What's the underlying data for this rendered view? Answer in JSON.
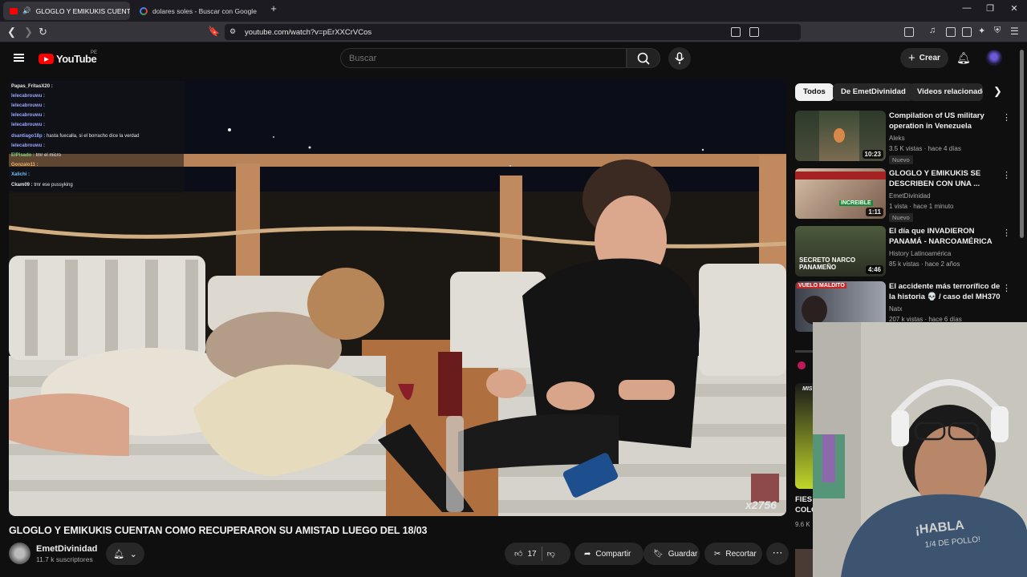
{
  "browser": {
    "tabs": [
      {
        "label": "GLOGLO Y EMIKUKIS CUENTA",
        "active": true,
        "icon": "youtube-favicon"
      },
      {
        "label": "dolares soles - Buscar con Google",
        "active": false,
        "icon": "google-favicon"
      }
    ],
    "new_tab": "+",
    "url": "youtube.com/watch?v=pErXXCrVCos"
  },
  "youtube": {
    "logo": "YouTube",
    "country": "PE",
    "search_placeholder": "Buscar",
    "create_label": "Crear"
  },
  "video": {
    "title": "GLOGLO Y EMIKUKIS CUENTAN COMO RECUPERARON SU AMISTAD LUEGO DEL 18/03",
    "channel": "EmetDivinidad",
    "subscribers": "11.7 k suscriptores",
    "likes": "17",
    "share_label": "Compartir",
    "save_label": "Guardar",
    "clip_label": "Recortar",
    "overlay_counter": "x2756"
  },
  "chat": [
    {
      "user": "Papas_FritasX20 :",
      "text": ""
    },
    {
      "user": "lelecabrouwu :",
      "text": ""
    },
    {
      "user": "lelecabrouwu :",
      "text": ""
    },
    {
      "user": "lelecabrouwu :",
      "text": ""
    },
    {
      "user": "lelecabrouwu :",
      "text": ""
    },
    {
      "user": "dsantiago18p :",
      "text": "hasta fuecalla, si el borracho dice la verdad"
    },
    {
      "user": "lelecabrouwu :",
      "text": ""
    },
    {
      "user": "ElPisado :",
      "text": "tmr el micro"
    },
    {
      "user": "Gonzalo11 :",
      "text": ""
    },
    {
      "user": "Xalichi :",
      "text": ""
    },
    {
      "user": "Ckam09 :",
      "text": "tmr ese pussyking"
    }
  ],
  "chips": [
    "Todos",
    "De EmetDivinidad",
    "Videos relacionado"
  ],
  "related": [
    {
      "title": "Compilation of US military operation in Venezuela",
      "channel": "Aleks",
      "meta": "3.5 K vistas · hace 4 días",
      "duration": "10:23",
      "badge": "Nuevo"
    },
    {
      "title": "GLOGLO Y EMIKUKIS SE DESCRIBEN CON UNA ...",
      "channel": "EmetDivinidad",
      "meta": "1 vista · hace 1 minuto",
      "duration": "1:11",
      "badge": "Nuevo",
      "thumb_text": "INCREIBLE"
    },
    {
      "title": "El día que INVADIERON PANAMÁ - NARCOAMÉRICA",
      "channel": "History Latinoamérica",
      "meta": "85 k vistas · hace 2 años",
      "duration": "4:46",
      "badge": "",
      "thumb_text": "SECRETO NARCO PANAMEÑO"
    },
    {
      "title": "El accidente más terrorífico de la historia 💀 / caso del MH370",
      "channel": "Natx",
      "meta": "207 k vistas · hace 6 días",
      "duration": "",
      "badge": "",
      "thumb_text": "VUELO MALDITO"
    }
  ],
  "partial_related": {
    "title_line1": "FIES",
    "title_line2": "COLO",
    "meta": "9.6 K",
    "thumb_text": "MIS"
  },
  "colors": {
    "bg": "#0f0f0f",
    "accent": "#ff0000",
    "chat_user": "#9ba6ff"
  }
}
